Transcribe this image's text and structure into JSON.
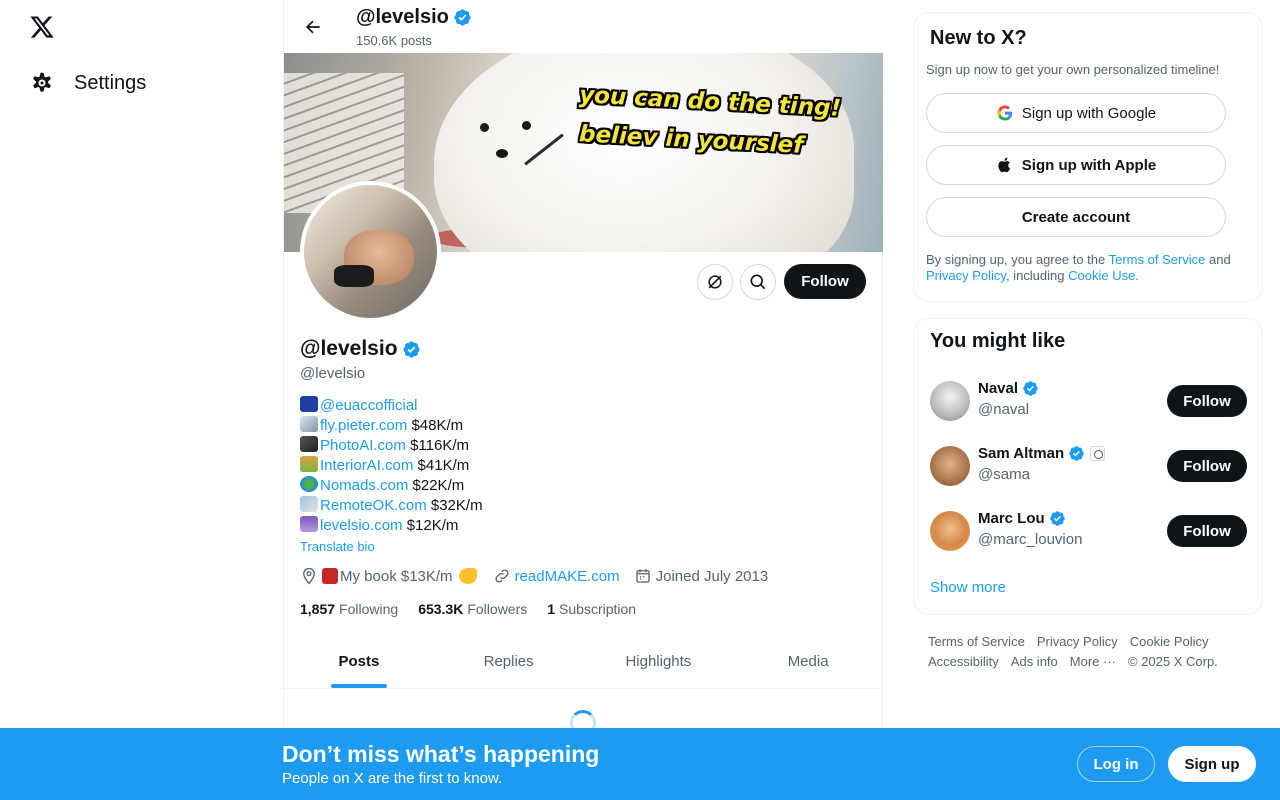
{
  "nav": {
    "settings_label": "Settings",
    "logo_icon": "x-logo-icon",
    "settings_icon": "gear-icon"
  },
  "header": {
    "name": "@levelsio",
    "post_count": "150.6K posts",
    "back_icon": "arrow-left-icon"
  },
  "banner": {
    "caption_line1": "you can do the ting!",
    "caption_line2": "believ in yourslef"
  },
  "profile": {
    "display_name": "@levelsio",
    "handle": "@levelsio",
    "bio": [
      {
        "emoji": "eu-flag",
        "link": "@euaccofficial",
        "value": ""
      },
      {
        "emoji": "airplane",
        "link": "fly.pieter.com",
        "value": "$48K/m"
      },
      {
        "emoji": "camera",
        "link": "PhotoAI.com",
        "value": "$116K/m"
      },
      {
        "emoji": "house",
        "link": "InteriorAI.com",
        "value": "$41K/m"
      },
      {
        "emoji": "globe",
        "link": "Nomads.com",
        "value": "$22K/m"
      },
      {
        "emoji": "satellite",
        "link": "RemoteOK.com",
        "value": "$32K/m"
      },
      {
        "emoji": "bikini",
        "link": "levelsio.com",
        "value": "$12K/m"
      }
    ],
    "translate_label": "Translate bio",
    "location": "My book $13K/m",
    "website": "readMAKE.com",
    "joined": "Joined July 2013",
    "following_count": "1,857",
    "following_label": "Following",
    "followers_count": "653.3K",
    "followers_label": "Followers",
    "subscription_count": "1",
    "subscription_label": "Subscription",
    "follow_label": "Follow"
  },
  "tabs": [
    {
      "label": "Posts",
      "active": true
    },
    {
      "label": "Replies",
      "active": false
    },
    {
      "label": "Highlights",
      "active": false
    },
    {
      "label": "Media",
      "active": false
    }
  ],
  "signup_card": {
    "title": "New to X?",
    "subtitle": "Sign up now to get your own personalized timeline!",
    "google_label": "Sign up with Google",
    "apple_label": "Sign up with Apple",
    "create_label": "Create account",
    "legal_prefix": "By signing up, you agree to the ",
    "terms_link": "Terms of Service",
    "legal_and": " and ",
    "privacy_link": "Privacy Policy",
    "legal_including": ", including ",
    "cookie_link": "Cookie Use."
  },
  "suggestions": {
    "title": "You might like",
    "items": [
      {
        "name": "Naval",
        "handle": "@naval",
        "follow": "Follow"
      },
      {
        "name": "Sam Altman",
        "handle": "@sama",
        "follow": "Follow"
      },
      {
        "name": "Marc Lou",
        "handle": "@marc_louvion",
        "follow": "Follow"
      }
    ],
    "show_more": "Show more"
  },
  "footer": {
    "links": [
      "Terms of Service",
      "Privacy Policy",
      "Cookie Policy",
      "Accessibility",
      "Ads info",
      "More ···",
      "© 2025 X Corp."
    ]
  },
  "bottom_banner": {
    "title": "Don’t miss what’s happening",
    "subtitle": "People on X are the first to know.",
    "login_label": "Log in",
    "signup_label": "Sign up"
  },
  "colors": {
    "accent": "#1d9bf0",
    "text": "#0f1419",
    "muted": "#536471"
  }
}
